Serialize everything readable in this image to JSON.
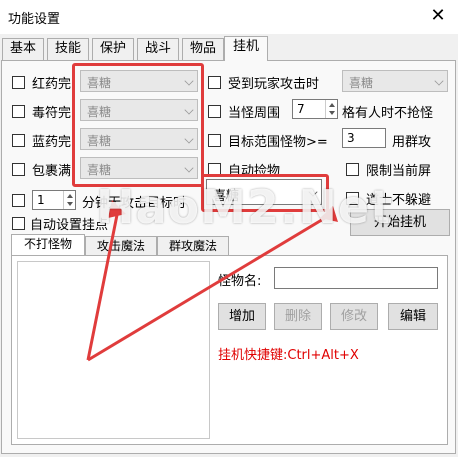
{
  "window": {
    "title": "功能设置",
    "close_glyph": "✕"
  },
  "tabs": [
    "基本",
    "技能",
    "保护",
    "战斗",
    "物品",
    "挂机"
  ],
  "active_tab": "挂机",
  "left_options": [
    {
      "label": "红药完",
      "value": "喜糖"
    },
    {
      "label": "毒符完",
      "value": "喜糖"
    },
    {
      "label": "蓝药完",
      "value": "喜糖"
    },
    {
      "label": "包裹满",
      "value": "喜糖"
    }
  ],
  "minutes_row": {
    "value": "1",
    "label": "分钟无攻击目标时",
    "combo_value": "喜糖"
  },
  "right_options": {
    "attacked_label": "受到玩家攻击时",
    "attacked_value": "喜糖",
    "nearby_label": "当怪周围",
    "nearby_value": "7",
    "nearby_suffix": "格有人时不抢怪",
    "target_label": "目标范围怪物>=",
    "target_value": "3",
    "target_suffix": "用群攻",
    "auto_pickup_label": "自动捡物",
    "limit_screen_label": "限制当前屏",
    "no_dodge_label": "道士不躲避"
  },
  "auto_row": {
    "auto_set_label": "自动设置挂点",
    "start_button": "开始挂机"
  },
  "inner_tabs": [
    "不打怪物",
    "攻击魔法",
    "群攻魔法"
  ],
  "monster": {
    "name_label": "怪物名:",
    "name_value": "",
    "add_button": "增加",
    "delete_button": "删除",
    "modify_button": "修改",
    "edit_button": "编辑"
  },
  "hotkey": "挂机快捷键:Ctrl+Alt+X",
  "watermark": "HaoM2.Net",
  "colors": {
    "highlight": "#e03c3c",
    "hotkey": "#e00000"
  }
}
